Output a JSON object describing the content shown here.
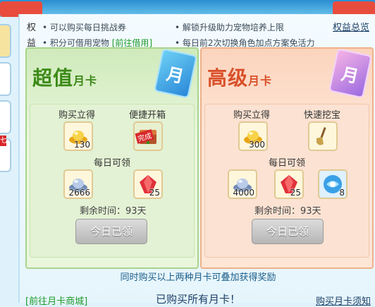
{
  "info": {
    "rights_char_1": "权",
    "rights_char_2": "益",
    "line1_left": "• 可以购买每日挑战券",
    "line1_right": "• 解锁升级助力宠物培养上限",
    "line2_left_prefix": "• 积分可借用宠物",
    "line2_left_link": "[前往借用]",
    "line2_right": "• 每日前2次切换角色加点方案免活力",
    "overview_link": "权益总览"
  },
  "card_value": {
    "title_big": "超值",
    "title_small": "月卡",
    "card_glyph": "月",
    "buy_label": "购买立得",
    "perk_label": "便捷开箱",
    "item_buy_count": "130",
    "perk_badge": "完成",
    "daily_label": "每日可领",
    "daily_items": [
      {
        "icon": "silver-ingot-icon",
        "count": "2666"
      },
      {
        "icon": "red-gem-icon",
        "count": "25"
      }
    ],
    "remain_label": "剩余时间：",
    "remain_value": "93天",
    "claim_button": "今日已领"
  },
  "card_premium": {
    "title_big": "高级",
    "title_small": "月卡",
    "card_glyph": "月",
    "buy_label": "购买立得",
    "perk_label": "快速挖宝",
    "item_buy_count": "300",
    "daily_label": "每日可领",
    "daily_items": [
      {
        "icon": "silver-ingot-icon",
        "count": "4000"
      },
      {
        "icon": "red-gem-icon",
        "count": "25"
      },
      {
        "icon": "blue-orb-icon",
        "count": "8"
      }
    ],
    "remain_label": "剩余时间：",
    "remain_value": "93天",
    "claim_button": "今日已领"
  },
  "footer": {
    "stack_note": "同时购买以上两种月卡可叠加获得奖励",
    "mall_link": "[前往月卡商城]",
    "all_bought": "已购买所有月卡！",
    "notice_link": "购买月卡须知"
  },
  "side": {
    "badge": "七"
  },
  "colors": {
    "value_card": "#e9f6dc",
    "premium_card": "#fde6d6",
    "value_title": "#3c8a18",
    "premium_title": "#d9502a",
    "link_green": "#1e9a2a",
    "link_blue": "#1b3f66"
  }
}
